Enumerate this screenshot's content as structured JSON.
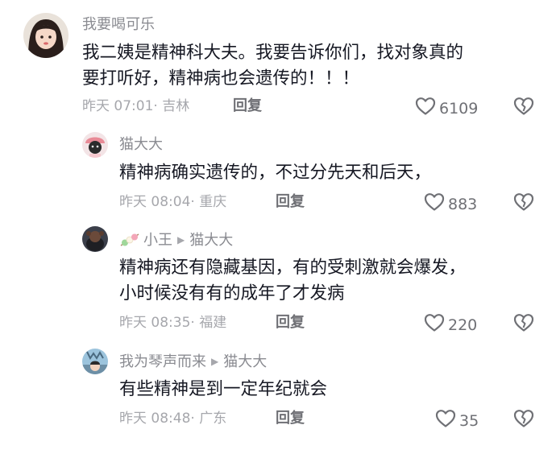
{
  "comments": [
    {
      "user": "我要喝可乐",
      "text_lines": [
        "我二姨是精神科大夫。我要告诉你们，找对象真的",
        "要打听好，精神病也会遗传的！！！"
      ],
      "time": "昨天 07:01",
      "location": "吉林",
      "reply_label": "回复",
      "likes": "6109"
    },
    {
      "user": "猫大大",
      "text_lines": [
        "精神病确实遗传的，不过分先天和后天，"
      ],
      "time": "昨天 08:04",
      "location": "重庆",
      "reply_label": "回复",
      "likes": "883"
    },
    {
      "user": "小王",
      "reply_to": "猫大大",
      "text_lines": [
        "精神病还有隐藏基因，有的受刺激就会爆发，",
        "小时候没有有的成年了才发病"
      ],
      "time": "昨天 08:35",
      "location": "福建",
      "reply_label": "回复",
      "likes": "220"
    },
    {
      "user": "我为琴声而来",
      "reply_to": "猫大大",
      "text_lines": [
        "有些精神是到一定年纪就会"
      ],
      "time": "昨天 08:48",
      "location": "广东",
      "reply_label": "回复",
      "likes": "35"
    }
  ],
  "separator": "·",
  "icons": {
    "like": "heart-outline-icon",
    "dislike": "broken-heart-icon",
    "reply_arrow": "triangle-right-icon",
    "sticker": "dango-sticker-icon"
  },
  "colors": {
    "text": "#161823",
    "username": "#8a8b91",
    "meta": "#a6a7ac",
    "action": "#6f7075"
  }
}
